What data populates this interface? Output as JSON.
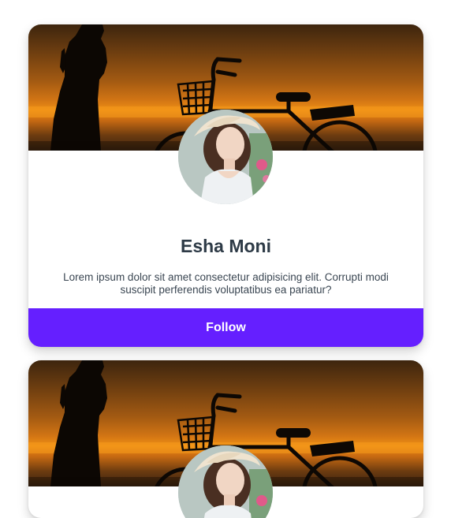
{
  "cards": [
    {
      "name": "Esha Moni",
      "description": "Lorem ipsum dolor sit amet consectetur adipisicing elit. Corrupti modi suscipit perferendis voluptatibus ea pariatur?",
      "follow_label": "Follow"
    },
    {
      "name": "",
      "description": "",
      "follow_label": ""
    }
  ],
  "colors": {
    "follow_button": "#651fff",
    "name_text": "#2e3b47",
    "body_text": "#3a4652"
  },
  "icons": {
    "cover": "sunset-bicycle-silhouette-image",
    "avatar": "profile-photo-image"
  }
}
